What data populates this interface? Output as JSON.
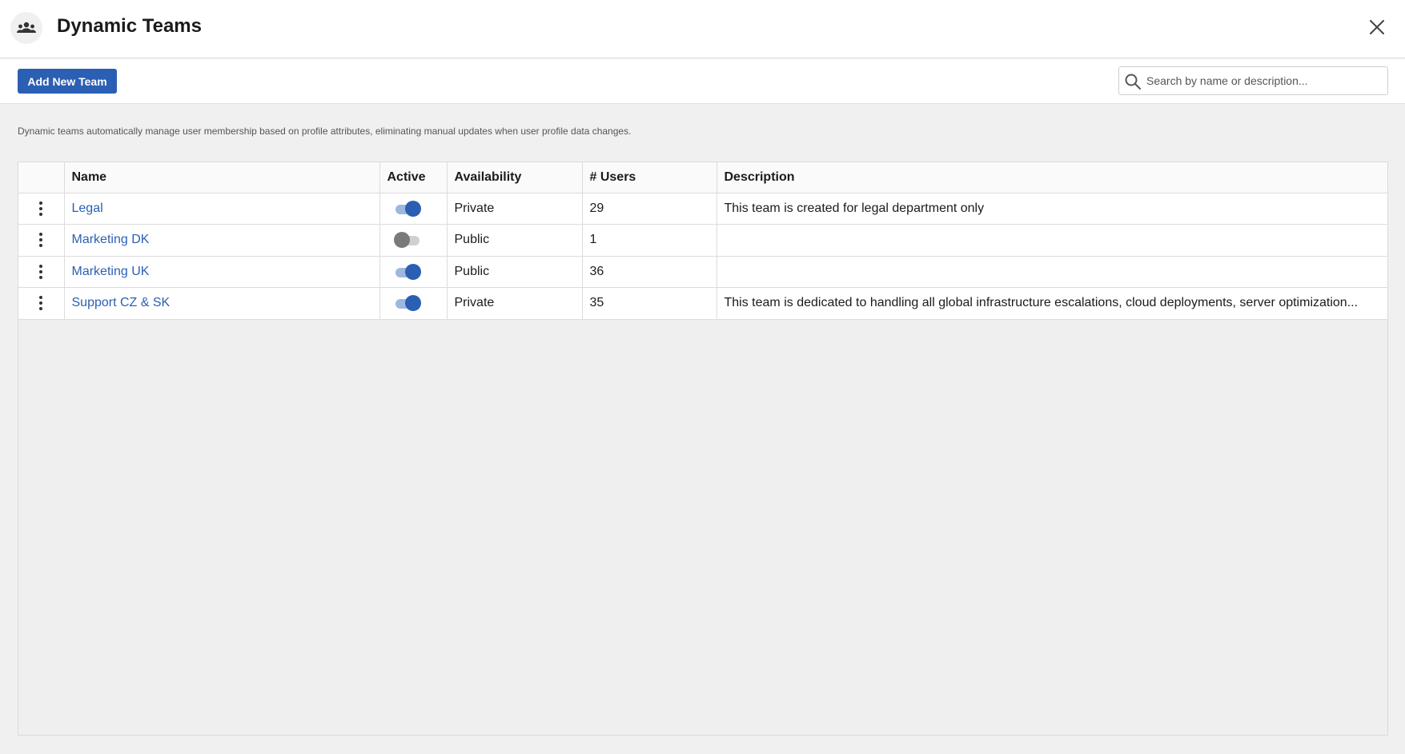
{
  "header": {
    "title": "Dynamic Teams",
    "icon": "team-icon",
    "close_icon": "close-icon"
  },
  "toolbar": {
    "add_label": "Add New Team",
    "search_placeholder": "Search by name or description...",
    "search_value": ""
  },
  "info_text": "Dynamic teams automatically manage user membership based on profile attributes, eliminating manual updates when user profile data changes.",
  "table": {
    "columns": [
      "",
      "Name",
      "Active",
      "Availability",
      "# Users",
      "Description"
    ],
    "rows": [
      {
        "name": "Legal",
        "active": true,
        "availability": "Private",
        "users": "29",
        "description": "This team is created for legal department only"
      },
      {
        "name": "Marketing DK",
        "active": false,
        "availability": "Public",
        "users": "1",
        "description": ""
      },
      {
        "name": "Marketing UK",
        "active": true,
        "availability": "Public",
        "users": "36",
        "description": ""
      },
      {
        "name": "Support CZ & SK",
        "active": true,
        "availability": "Private",
        "users": "35",
        "description": "This team is dedicated to handling all global infrastructure escalations, cloud deployments, server optimization..."
      }
    ]
  },
  "colors": {
    "accent": "#2b5fb3",
    "toggle_on_track": "#9db7df",
    "toggle_off_knob": "#7a7a7a",
    "background": "#f0f0f0"
  }
}
